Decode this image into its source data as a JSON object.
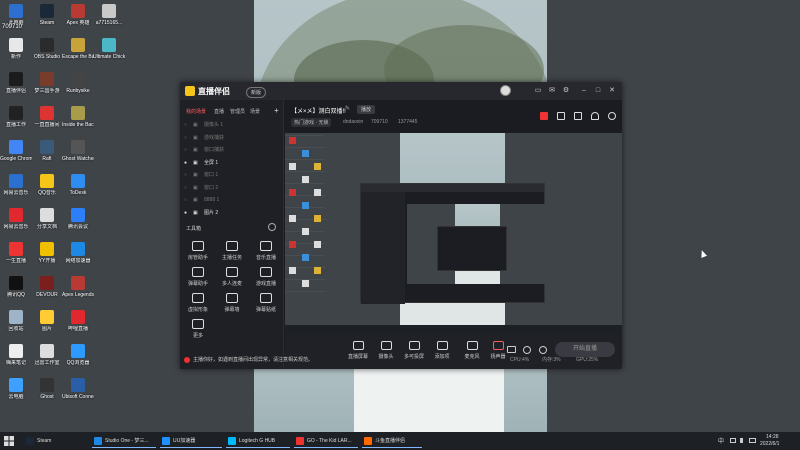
{
  "desktop": {
    "icons": [
      {
        "label": "此电脑",
        "color": "#2c6fcf"
      },
      {
        "label": "Steam",
        "color": "#1b2838"
      },
      {
        "label": "Apex 英雄",
        "color": "#b93a32"
      },
      {
        "label": "a7715165...",
        "color": "#c9c9c9"
      },
      {
        "label": "新作",
        "color": "#e8e8e8"
      },
      {
        "label": "OBS Studio",
        "color": "#2b2b2b"
      },
      {
        "label": "Escape the Backrooms",
        "color": "#c8a33a"
      },
      {
        "label": "Ultimate Chicken...",
        "color": "#4cb8c7"
      },
      {
        "label": "直播伴侣",
        "color": "#1c1c1c"
      },
      {
        "label": "梦三国手游",
        "color": "#7a3c2a"
      },
      {
        "label": "Runbysike",
        "color": "#444"
      },
      {
        "label": "直播工作",
        "color": "#222"
      },
      {
        "label": "一直直播间",
        "color": "#d33"
      },
      {
        "label": "Inside the Backrooms",
        "color": "#a89b4a"
      },
      {
        "label": "Google Chrome",
        "color": "#4285f4"
      },
      {
        "label": "Raft",
        "color": "#3a5a7a"
      },
      {
        "label": "Ghost Watchers",
        "color": "#555"
      },
      {
        "label": "网易云音乐",
        "color": "#2b6fcf"
      },
      {
        "label": "QQ音乐",
        "color": "#f5c518"
      },
      {
        "label": "ToDesk",
        "color": "#2f8cf0"
      },
      {
        "label": "网易云音乐",
        "color": "#e0282e"
      },
      {
        "label": "分享文档",
        "color": "#ddd"
      },
      {
        "label": "腾讯会议",
        "color": "#2d7ff9"
      },
      {
        "label": "一生直播",
        "color": "#e33"
      },
      {
        "label": "YY开播",
        "color": "#f0c000"
      },
      {
        "label": "网络加速器",
        "color": "#1e88e5"
      },
      {
        "label": "腾讯QQ",
        "color": "#111"
      },
      {
        "label": "DEVOUR",
        "color": "#7a1e1e"
      },
      {
        "label": "Apex Legends",
        "color": "#b93a32"
      },
      {
        "label": "回收站",
        "color": "#9fb4c8"
      },
      {
        "label": "图片",
        "color": "#ffcc33"
      },
      {
        "label": "哔哩直播",
        "color": "#e0282e"
      },
      {
        "label": "嗨来笔记",
        "color": "#eee"
      },
      {
        "label": "迅雷工作室",
        "color": "#ddd"
      },
      {
        "label": "QQ浏览器",
        "color": "#2e9afe"
      },
      {
        "label": "云电脑",
        "color": "#3da0ff"
      },
      {
        "label": "Ghost",
        "color": "#333"
      },
      {
        "label": "Ubisoft Connect",
        "color": "#2a5fa8"
      }
    ],
    "top_left_badge": "709710"
  },
  "app": {
    "name": "直播伴侣",
    "badge": "新版",
    "window_controls": [
      "–",
      "□",
      "✕"
    ],
    "panel_tabs": [
      "我的场景",
      "直播",
      "管理员",
      "场景"
    ],
    "add_symbol": "+",
    "sources": [
      {
        "name": "摄像头 1",
        "active": false
      },
      {
        "name": "游戏捕获",
        "active": false
      },
      {
        "name": "窗口捕获",
        "active": false
      },
      {
        "name": "全屏 1",
        "active": true
      },
      {
        "name": "窗口 1",
        "active": false
      },
      {
        "name": "窗口 2",
        "active": false
      },
      {
        "name": "8888 1",
        "active": false
      },
      {
        "name": "图片 2",
        "active": true
      }
    ],
    "toolbox_title": "工具箱",
    "tools": [
      "房管助手",
      "主播任务",
      "音乐直播",
      "弹幕助手",
      "多人连麦",
      "游戏直播",
      "虚拟形象",
      "弹幕墙",
      "弹幕贴纸",
      "更多"
    ],
    "stream_title": "【メ×メ】测白双播!!",
    "stream_badge": "播放",
    "stream_meta": [
      "热门游戏 · 无锁",
      "dndaoxin",
      "709710",
      "1377445"
    ],
    "bottom_buttons": [
      "直播屏幕",
      "摄像头",
      "多可投屏",
      "添加项",
      "麦克风",
      "扬声器"
    ],
    "start_button": "开始直播",
    "notice": "主播你好，如遇到直播间出现异常，请注意相关规范。",
    "stats": [
      "CPU:4%",
      "内存:3%",
      "GPU:25%"
    ]
  },
  "taskbar": {
    "tasks": [
      {
        "label": "Steam",
        "color": "#1b2838",
        "running": false
      },
      {
        "label": "Studio One - 梦三...",
        "color": "#1e88e5",
        "running": true
      },
      {
        "label": "UU加速器",
        "color": "#1e90ff",
        "running": true
      },
      {
        "label": "Logitech G HUB",
        "color": "#00b8fc",
        "running": true
      },
      {
        "label": "GO - The Kid LAR...",
        "color": "#e33",
        "running": true
      },
      {
        "label": "斗鱼直播伴侣",
        "color": "#ff6a00",
        "running": true
      }
    ],
    "clock_time": "14:28",
    "clock_date": "2022/6/1",
    "ime": "中"
  }
}
